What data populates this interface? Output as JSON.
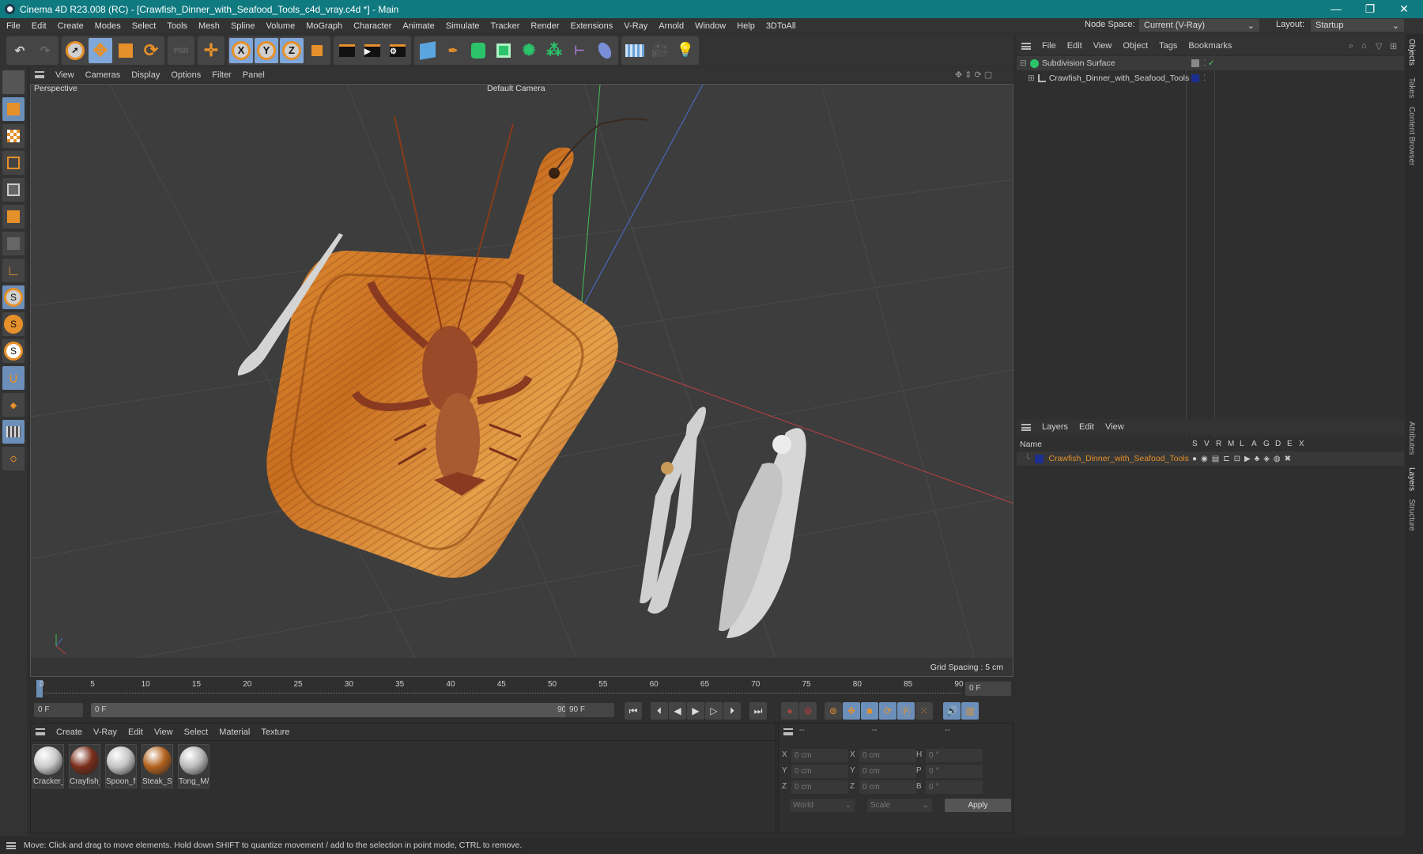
{
  "window": {
    "title": "Cinema 4D R23.008 (RC) - [Crawfish_Dinner_with_Seafood_Tools_c4d_vray.c4d *] - Main",
    "minimize": "—",
    "maximize": "❐",
    "close": "✕"
  },
  "menu": [
    "File",
    "Edit",
    "Create",
    "Modes",
    "Select",
    "Tools",
    "Mesh",
    "Spline",
    "Volume",
    "MoGraph",
    "Character",
    "Animate",
    "Simulate",
    "Tracker",
    "Render",
    "Extensions",
    "V-Ray",
    "Arnold",
    "Window",
    "Help",
    "3DToAll"
  ],
  "node_space": {
    "label": "Node Space:",
    "value": "Current (V-Ray)"
  },
  "layout": {
    "label": "Layout:",
    "value": "Startup"
  },
  "toolbar": {
    "x": "X",
    "y": "Y",
    "z": "Z",
    "psr": "PSR"
  },
  "viewport": {
    "menu": [
      "View",
      "Cameras",
      "Display",
      "Options",
      "Filter",
      "Panel"
    ],
    "view_name": "Perspective",
    "camera": "Default Camera",
    "grid_spacing": "Grid Spacing : 5 cm"
  },
  "timeline": {
    "ticks": [
      "0",
      "5",
      "10",
      "15",
      "20",
      "25",
      "30",
      "35",
      "40",
      "45",
      "50",
      "55",
      "60",
      "65",
      "70",
      "75",
      "80",
      "85",
      "90"
    ],
    "current_frame": "0 F",
    "start": "0 F",
    "range_start": "0 F",
    "range_end": "90 F",
    "end": "90 F"
  },
  "materials": {
    "menu": [
      "Create",
      "V-Ray",
      "Edit",
      "View",
      "Select",
      "Material",
      "Texture"
    ],
    "items": [
      {
        "label": "Cracker_",
        "color": "#c9c9c9"
      },
      {
        "label": "Crayfish_",
        "color": "#7a2e1a"
      },
      {
        "label": "Spoon_fi",
        "color": "#c4c4c4"
      },
      {
        "label": "Steak_Se",
        "color": "#b3621e"
      },
      {
        "label": "Tong_M/",
        "color": "#b9b9b9"
      }
    ]
  },
  "coords": {
    "header": [
      "--",
      "--",
      "--"
    ],
    "rows": [
      {
        "a": "X",
        "av": "0 cm",
        "b": "X",
        "bv": "0 cm",
        "c": "H",
        "cv": "0 °"
      },
      {
        "a": "Y",
        "av": "0 cm",
        "b": "Y",
        "bv": "0 cm",
        "c": "P",
        "cv": "0 °"
      },
      {
        "a": "Z",
        "av": "0 cm",
        "b": "Z",
        "bv": "0 cm",
        "c": "B",
        "cv": "0 °"
      }
    ],
    "world": "World",
    "scale": "Scale",
    "apply": "Apply"
  },
  "status": "Move: Click and drag to move elements. Hold down SHIFT to quantize movement / add to the selection in point mode, CTRL to remove.",
  "objects": {
    "menu": [
      "File",
      "Edit",
      "View",
      "Object",
      "Tags",
      "Bookmarks"
    ],
    "items": [
      {
        "name": "Subdivision Surface"
      },
      {
        "name": "Crawfish_Dinner_with_Seafood_Tools"
      }
    ]
  },
  "layers": {
    "menu": [
      "Layers",
      "Edit",
      "View"
    ],
    "name_header": "Name",
    "columns": [
      "S",
      "V",
      "R",
      "M",
      "L",
      "A",
      "G",
      "D",
      "E",
      "X"
    ],
    "items": [
      {
        "name": "Crawfish_Dinner_with_Seafood_Tools",
        "color": "#1a2f8f"
      }
    ]
  },
  "side_tabs": [
    "Objects",
    "Takes",
    "Content Browser",
    "Attributes",
    "Layers",
    "Structure"
  ]
}
